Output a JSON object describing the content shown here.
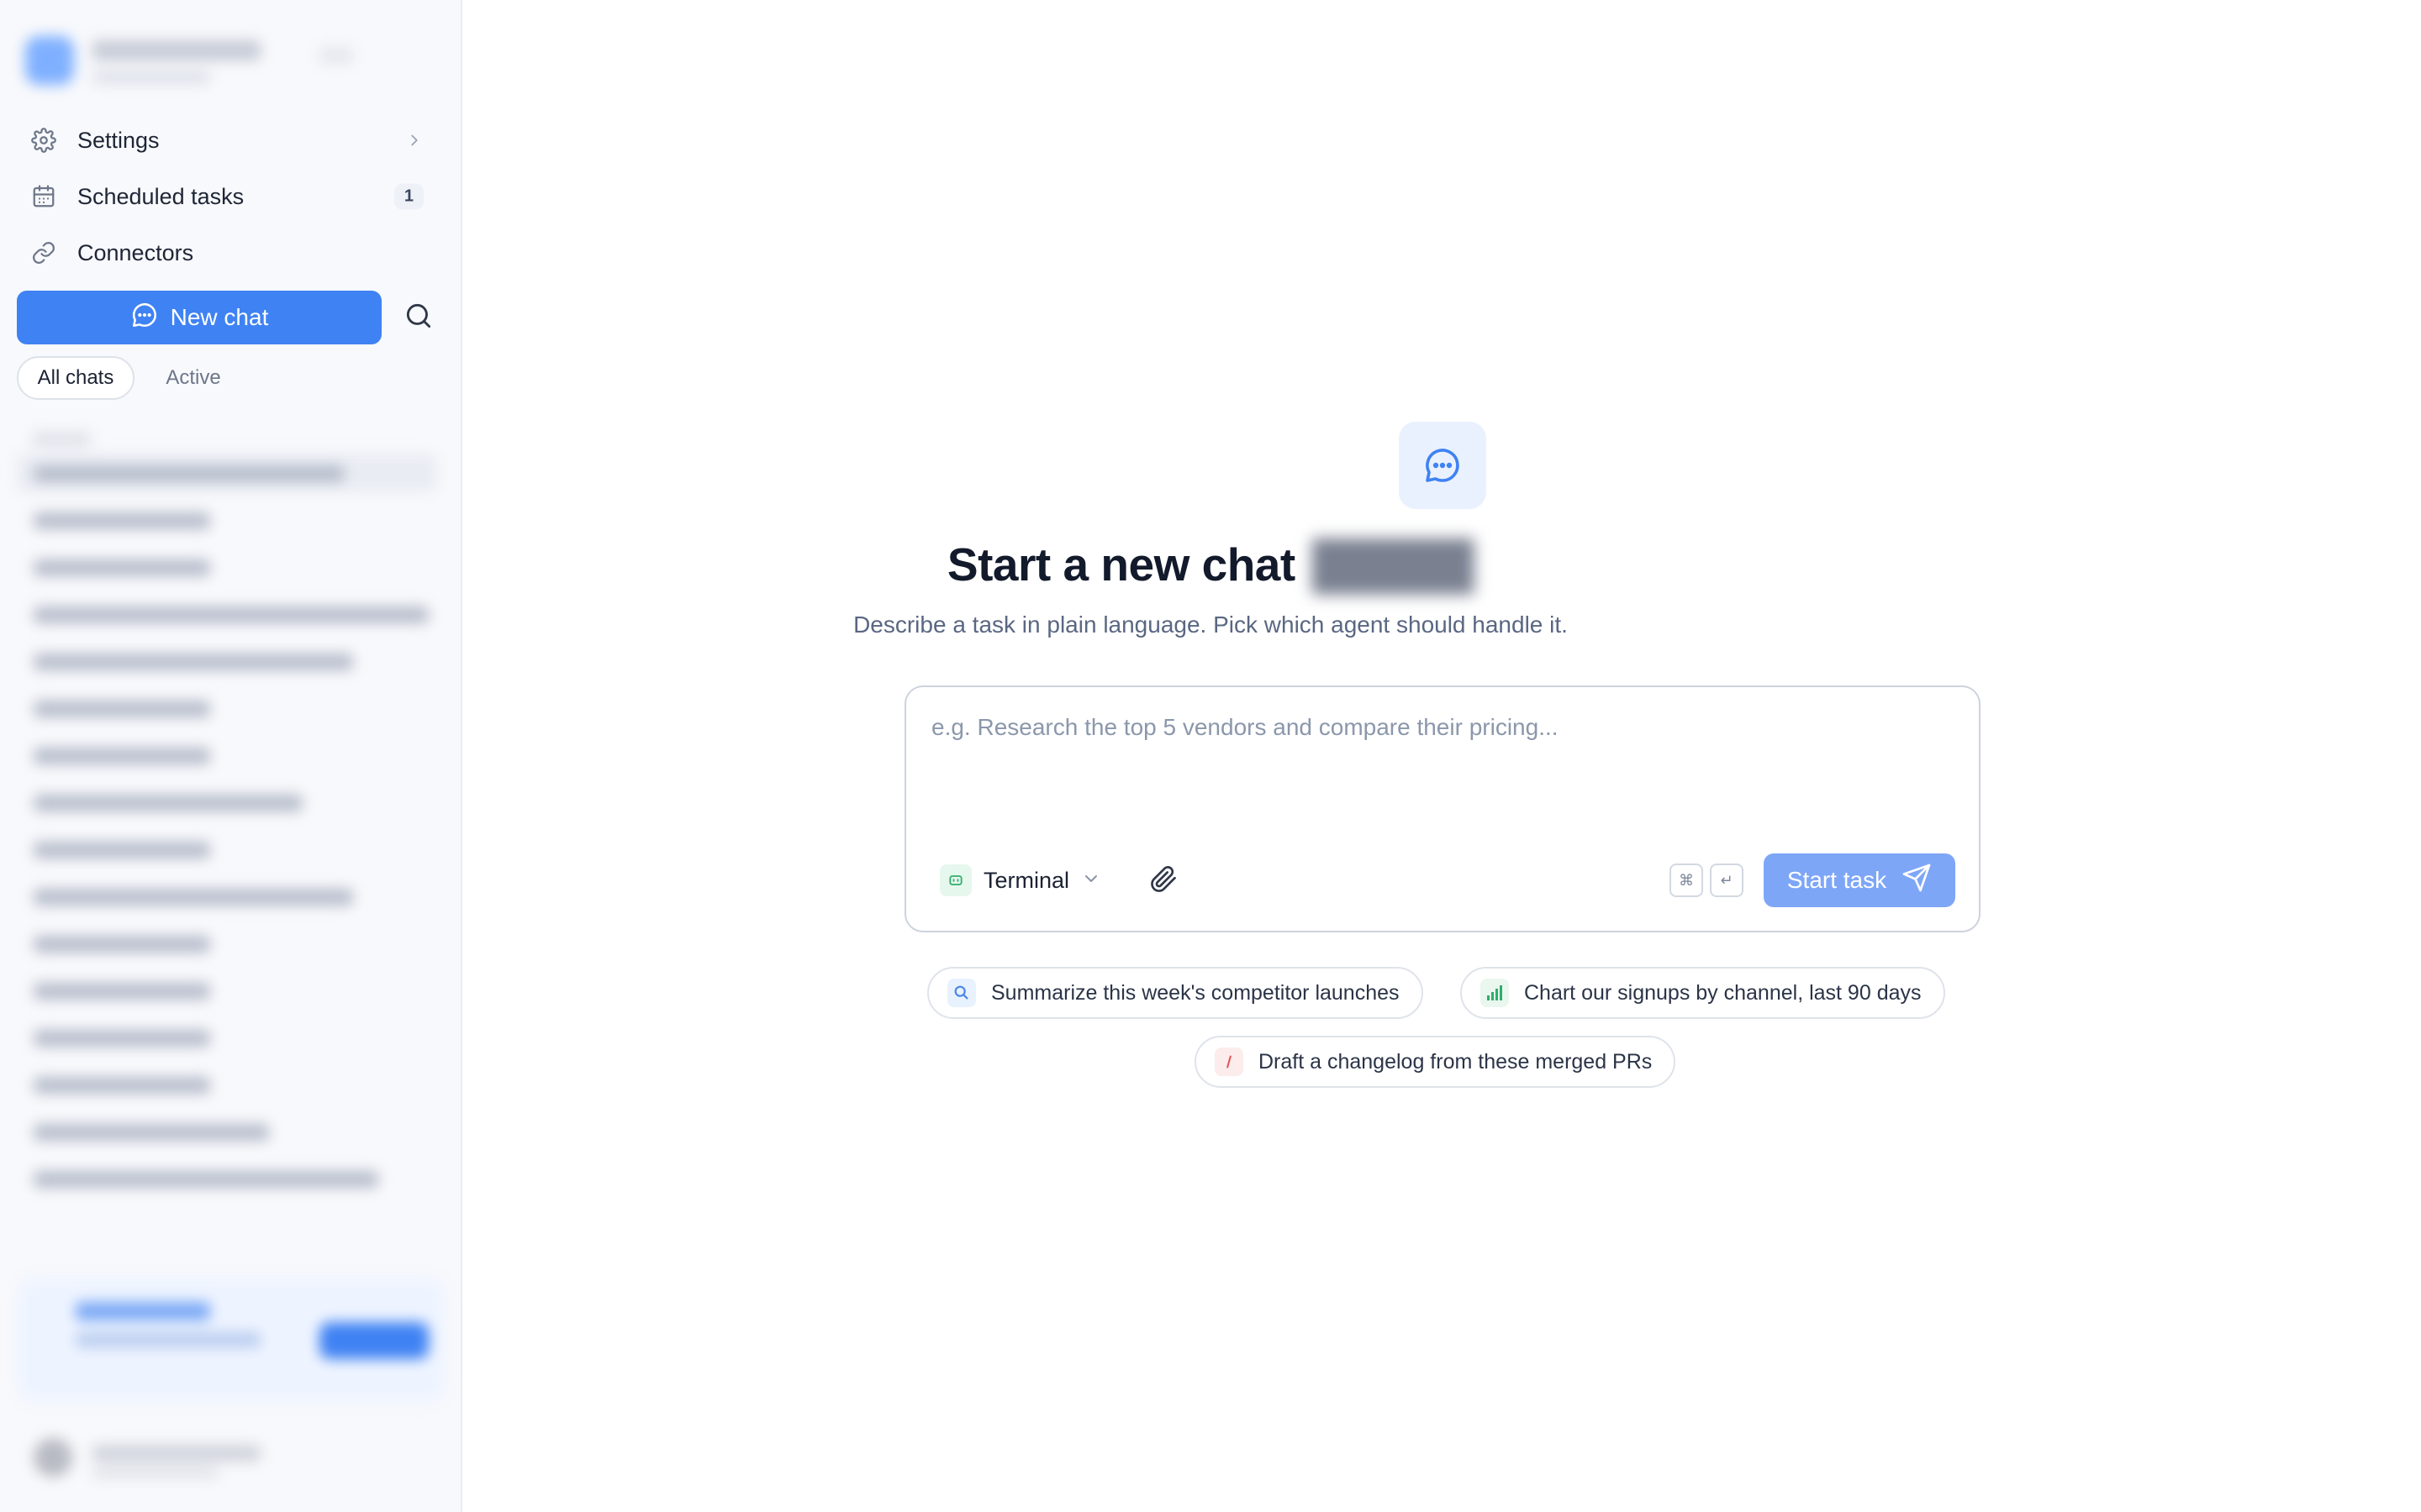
{
  "sidebar": {
    "nav": [
      {
        "label": "Settings",
        "icon": "gear-icon"
      },
      {
        "label": "Scheduled tasks",
        "icon": "calendar-icon",
        "badge": "1"
      },
      {
        "label": "Connectors",
        "icon": "link-icon"
      }
    ],
    "new_chat_label": "New chat",
    "filters": {
      "all": "All chats",
      "active": "Active"
    }
  },
  "main": {
    "title": "Start a new chat",
    "subtitle": "Describe a task in plain language. Pick which agent should handle it.",
    "composer": {
      "placeholder": "e.g. Research the top 5 vendors and compare their pricing...",
      "agent": "Terminal",
      "kbd_modifier": "⌘",
      "kbd_enter": "↵",
      "start_label": "Start task"
    },
    "suggestions": [
      {
        "label": "Summarize this week's competitor launches",
        "icon": "magnifier-icon"
      },
      {
        "label": "Chart our signups by channel, last 90 days",
        "icon": "bar-chart-icon"
      },
      {
        "label": "Draft a changelog from these merged PRs",
        "icon": "document-icon"
      }
    ]
  },
  "colors": {
    "accent": "#3f82f3",
    "accent_light": "#7ea6f7",
    "sidebar_bg": "#f8f9fc"
  }
}
